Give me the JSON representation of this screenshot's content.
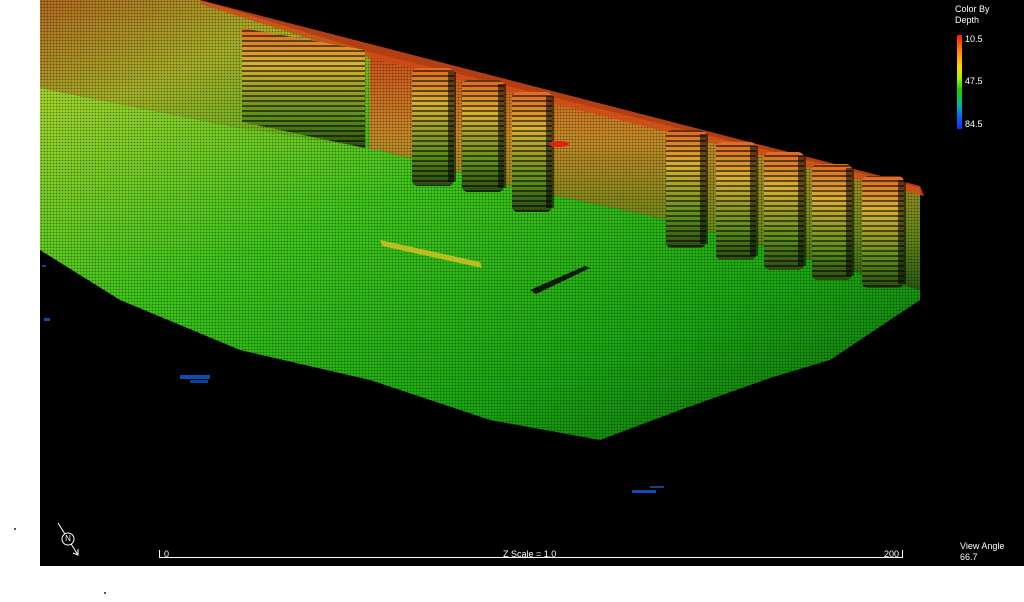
{
  "legend": {
    "title": "Color By\nDepth",
    "min_label": "10.5",
    "mid_label": "47.5",
    "max_label": "84.5",
    "colors": [
      "#ff1a00",
      "#ffd800",
      "#19d000",
      "#1a28ff"
    ]
  },
  "scale": {
    "start_label": "0",
    "end_label": "200",
    "z_scale_label": "Z Scale = 1.0"
  },
  "view_angle": {
    "label": "View Angle",
    "value": "66.7"
  },
  "compass": {
    "letter": "N",
    "icon": "north-arrow-icon"
  },
  "scene": {
    "background": "#000000",
    "description_colors": {
      "shallow": "#d84a10",
      "mid": "#d8c020",
      "deep": "#20b820"
    }
  }
}
